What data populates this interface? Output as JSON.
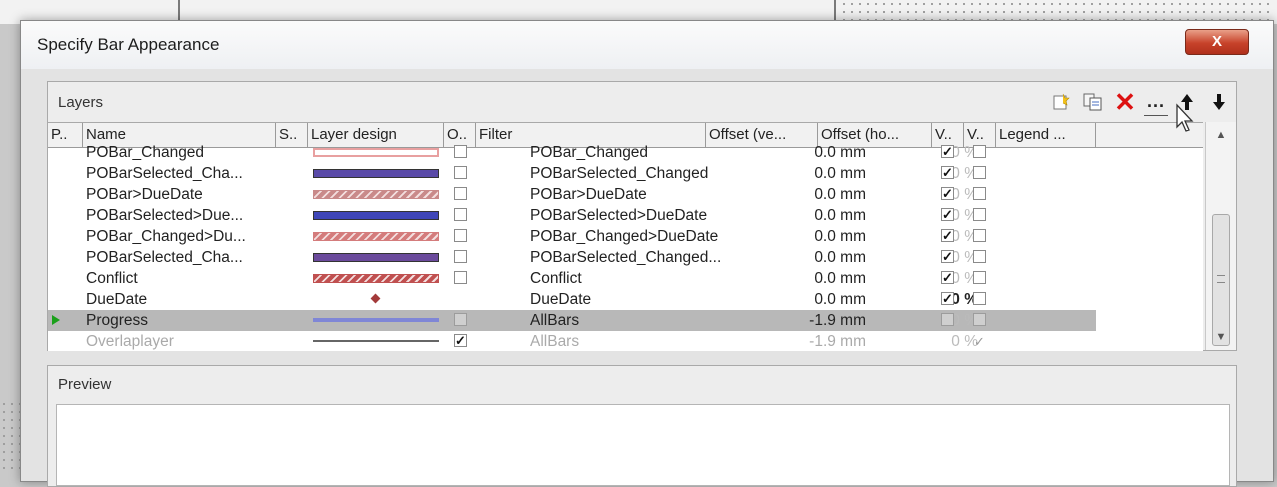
{
  "window": {
    "title": "Specify Bar Appearance",
    "close_label": "X"
  },
  "layers": {
    "label": "Layers",
    "toolbar": {
      "more_label": "...",
      "up_arrow": "🡡",
      "down_arrow": "🡣"
    },
    "columns": [
      "P..",
      "Name",
      "S..",
      "Layer design",
      "O..",
      "Filter",
      "Offset (ve...",
      "Offset (ho...",
      "V..",
      "V..",
      "Legend ..."
    ],
    "rows": [
      {
        "name": "POBar_Changed",
        "swatch": "#e8a0a0",
        "swatch_style": "outline",
        "o_checked": false,
        "filter": "POBar_Changed",
        "offset_v": "0.0 mm",
        "offset_h": "0 %",
        "v1": true,
        "v2": false,
        "dim": false,
        "current": false
      },
      {
        "name": "POBarSelected_Cha...",
        "swatch": "#5a4aa8",
        "swatch_style": "solid",
        "o_checked": false,
        "filter": "POBarSelected_Changed",
        "offset_v": "0.0 mm",
        "offset_h": "0 %",
        "v1": true,
        "v2": false,
        "dim": false,
        "current": false
      },
      {
        "name": "POBar>DueDate",
        "swatch": "#c98a8a",
        "swatch_style": "hatched",
        "o_checked": false,
        "filter": "POBar>DueDate",
        "offset_v": "0.0 mm",
        "offset_h": "0 %",
        "v1": true,
        "v2": false,
        "dim": false,
        "current": false
      },
      {
        "name": "POBarSelected>Due...",
        "swatch": "#3f46b8",
        "swatch_style": "solid",
        "o_checked": false,
        "filter": "POBarSelected>DueDate",
        "offset_v": "0.0 mm",
        "offset_h": "0 %",
        "v1": true,
        "v2": false,
        "dim": false,
        "current": false
      },
      {
        "name": "POBar_Changed>Du...",
        "swatch": "#d47c7c",
        "swatch_style": "hatched",
        "o_checked": false,
        "filter": "POBar_Changed>DueDate",
        "offset_v": "0.0 mm",
        "offset_h": "0 %",
        "v1": true,
        "v2": false,
        "dim": false,
        "current": false
      },
      {
        "name": "POBarSelected_Cha...",
        "swatch": "#6b4a9c",
        "swatch_style": "solid",
        "o_checked": false,
        "filter": "POBarSelected_Changed...",
        "offset_v": "0.0 mm",
        "offset_h": "0 %",
        "v1": true,
        "v2": false,
        "dim": false,
        "current": false
      },
      {
        "name": "Conflict",
        "swatch": "#c05050",
        "swatch_style": "hatched",
        "o_checked": false,
        "filter": "Conflict",
        "offset_v": "0.0 mm",
        "offset_h": "0 %",
        "v1": true,
        "v2": false,
        "dim": false,
        "current": false
      },
      {
        "name": "DueDate",
        "swatch": "#a33a3a",
        "swatch_style": "diamond",
        "o_checked": null,
        "filter": "DueDate",
        "offset_v": "0.0 mm",
        "offset_h": "0 %",
        "v1": true,
        "v2": false,
        "dim": false,
        "current": false,
        "bold_h": true
      },
      {
        "name": "Progress",
        "swatch": "#7f86d6",
        "swatch_style": "thin",
        "o_checked": false,
        "filter": "AllBars",
        "offset_v": "-1.9 mm",
        "offset_h": "0 %",
        "v1": false,
        "v2": false,
        "dim": false,
        "current": true
      },
      {
        "name": "Overlaplayer",
        "swatch": "#666666",
        "swatch_style": "line",
        "o_checked": true,
        "filter": "AllBars",
        "offset_v": "-1.9 mm",
        "offset_h": "0 %",
        "v1": null,
        "v2": "tick",
        "dim": true,
        "current": false
      }
    ]
  },
  "preview": {
    "label": "Preview"
  }
}
